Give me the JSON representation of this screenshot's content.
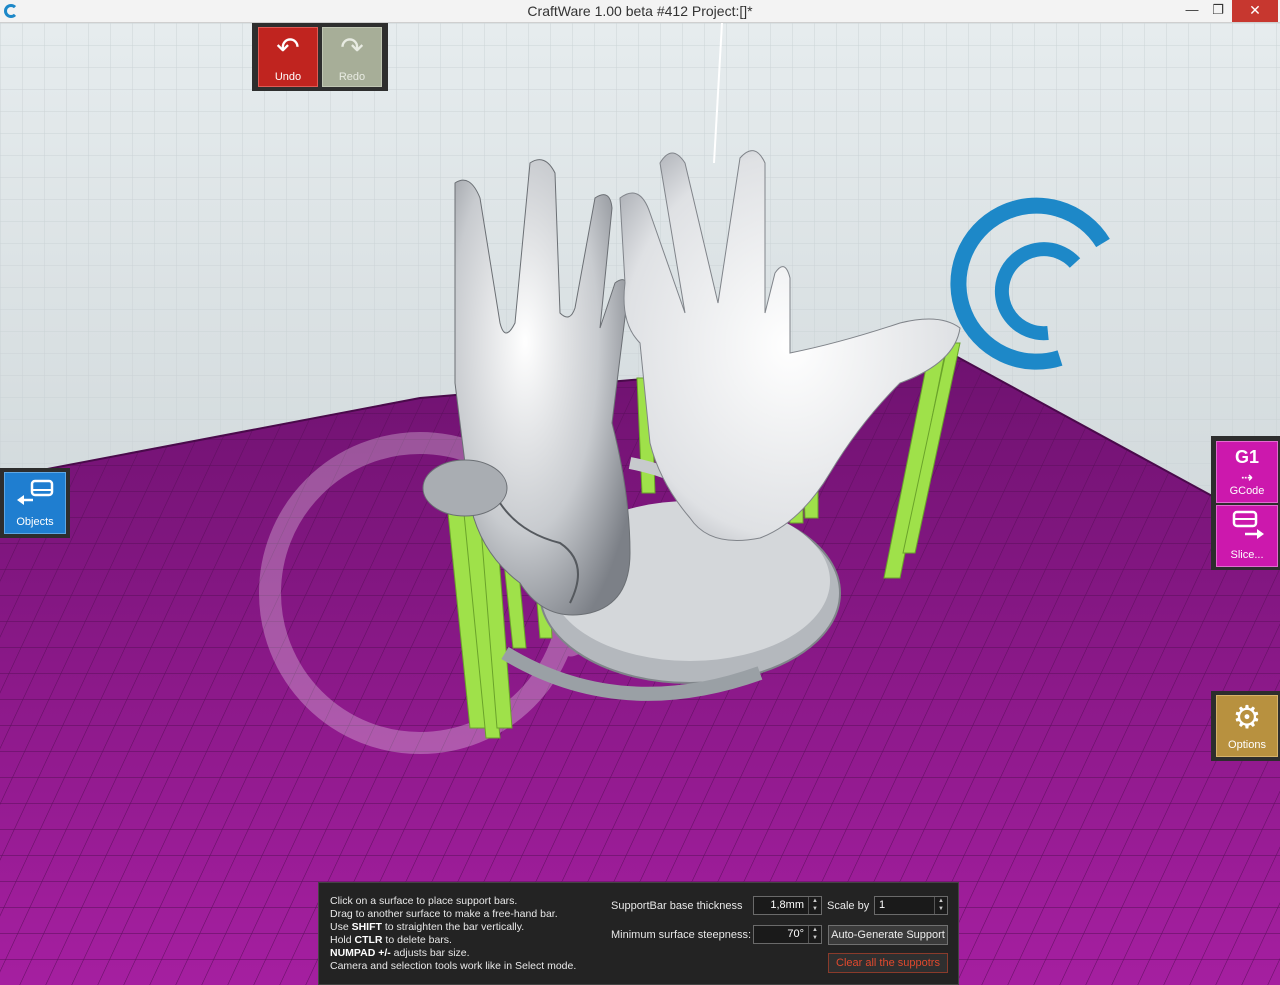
{
  "window": {
    "title": "CraftWare 1.00 beta #412   Project:[]*",
    "minimize_glyph": "—",
    "maximize_glyph": "❐",
    "close_glyph": "✕"
  },
  "toolbar": {
    "undo_label": "Undo",
    "redo_label": "Redo",
    "undo_icon": "undo-arrow-icon",
    "redo_icon": "redo-arrow-icon"
  },
  "left_panel": {
    "objects_label": "Objects",
    "objects_icon": "objects-icon"
  },
  "right_panel": {
    "gcode_glyph": "G1",
    "gcode_label": "GCode",
    "slice_label": "Slice...",
    "options_label": "Options"
  },
  "support_panel": {
    "help_lines": [
      {
        "pre": "Click on a surface to place support bars.",
        "bold": "",
        "post": ""
      },
      {
        "pre": "Drag to another surface to make a free-hand bar.",
        "bold": "",
        "post": ""
      },
      {
        "pre": "Use ",
        "bold": "SHIFT",
        "post": " to straighten the bar vertically."
      },
      {
        "pre": "Hold ",
        "bold": "CTLR",
        "post": " to delete bars."
      },
      {
        "pre": "",
        "bold": "NUMPAD +/-",
        "post": " adjusts bar size."
      },
      {
        "pre": "Camera and selection tools work like in Select mode.",
        "bold": "",
        "post": ""
      }
    ],
    "base_thickness_label": "SupportBar base thickness",
    "base_thickness_value": "1,8mm",
    "scale_label": "Scale by",
    "scale_value": "1",
    "steepness_label": "Minimum surface steepness:",
    "steepness_value": "70°",
    "auto_generate_label": "Auto-Generate Support",
    "clear_label": "Clear all the suppotrs"
  },
  "colors": {
    "undo": "#c0241f",
    "redo": "#a7ae98",
    "objects": "#1f7ed0",
    "gcode": "#cc18ad",
    "options": "#b8913f",
    "platform": "#8a1c86",
    "support_bars": "#9fe14a",
    "logo": "#1d88c8"
  }
}
